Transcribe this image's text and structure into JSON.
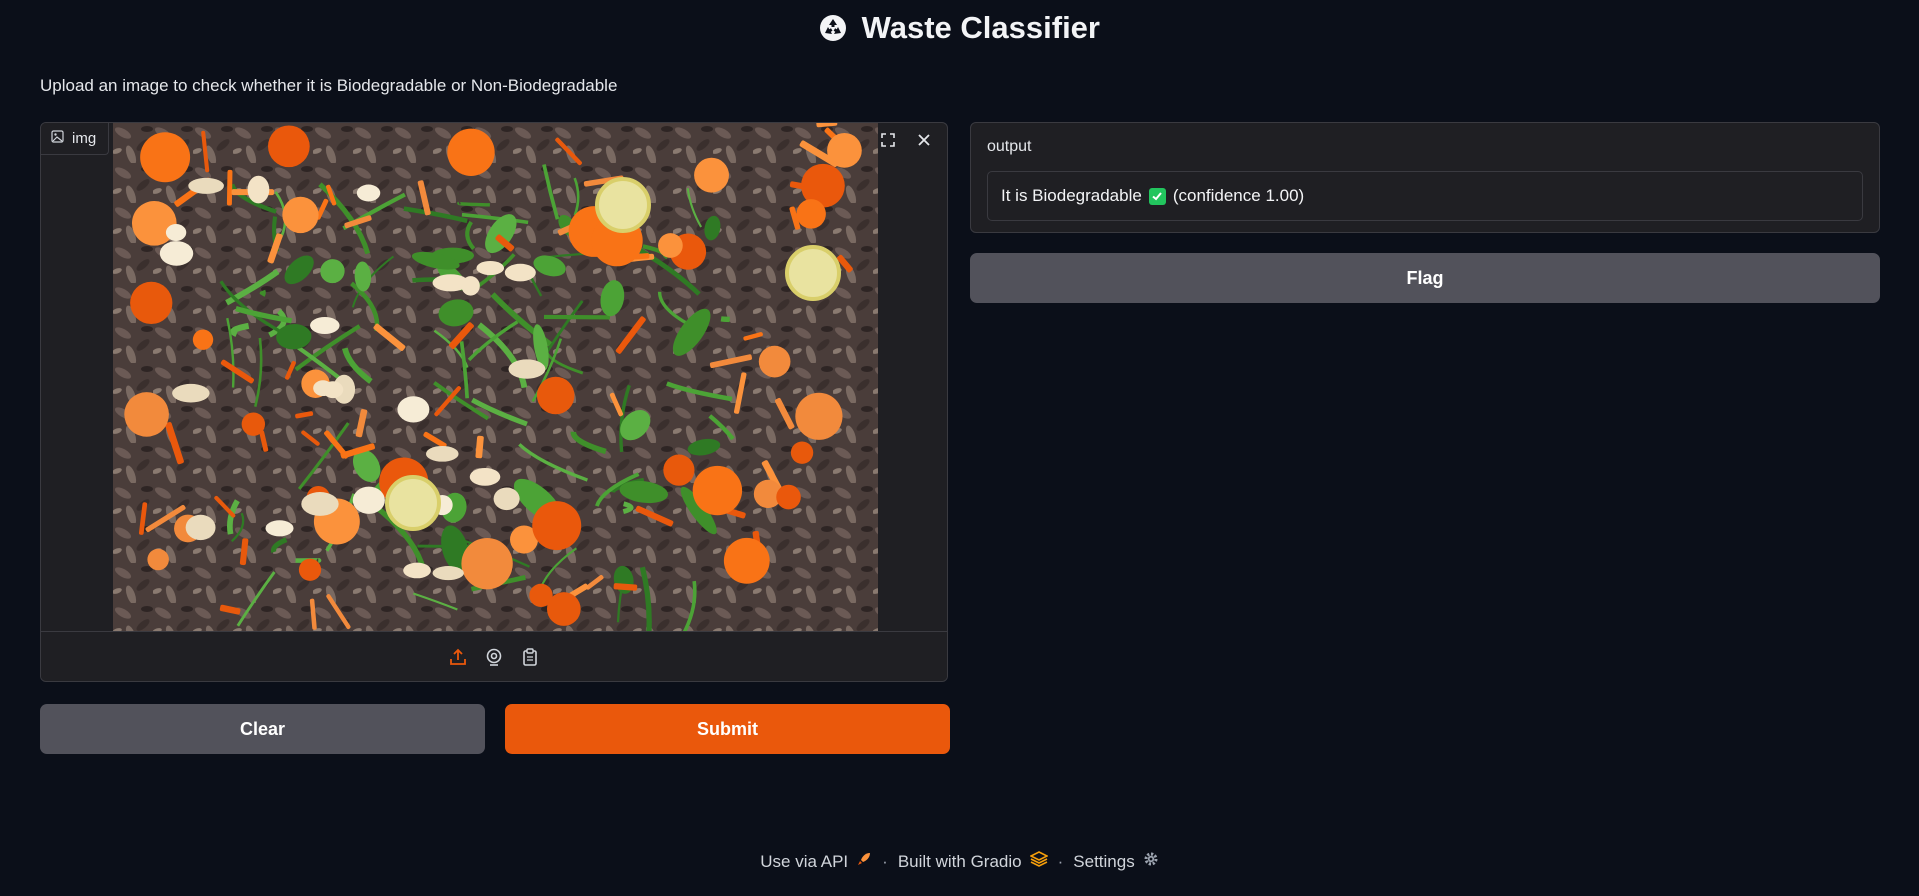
{
  "header": {
    "title": "Waste Classifier",
    "description": "Upload an image to check whether it is Biodegradable or Non-Biodegradable"
  },
  "input_image": {
    "label": "img",
    "image_alt": "compost pile of orange peels, greens and dry leaves",
    "toolbar_icons": [
      "upload-icon",
      "webcam-icon",
      "clipboard-icon"
    ],
    "corner_icons": [
      "fullscreen-icon",
      "close-icon"
    ]
  },
  "buttons": {
    "clear": "Clear",
    "submit": "Submit",
    "flag": "Flag"
  },
  "output": {
    "label": "output",
    "text_prefix": "It is Biodegradable",
    "text_suffix": "(confidence 1.00)"
  },
  "footer": {
    "api": "Use via API",
    "built": "Built with Gradio",
    "settings": "Settings"
  },
  "colors": {
    "background": "#0b0f19",
    "panel": "#1f1f23",
    "accent": "#ea580c",
    "secondary_button": "#52525b",
    "check": "#22c55e"
  }
}
